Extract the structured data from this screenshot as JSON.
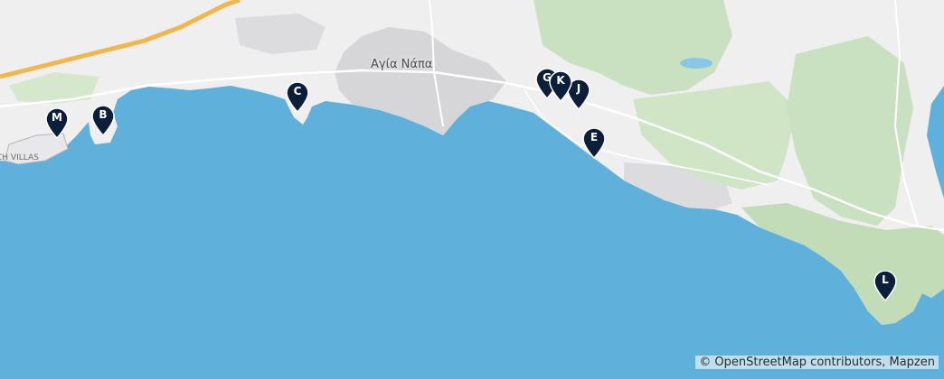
{
  "map": {
    "town_label": "Αγία Νάπα",
    "area_label": "CH VILLAS",
    "attribution": "© OpenStreetMap contributors, Mapzen"
  },
  "markers": [
    {
      "id": "M",
      "label": "M"
    },
    {
      "id": "B",
      "label": "B"
    },
    {
      "id": "C",
      "label": "C"
    },
    {
      "id": "G",
      "label": "G"
    },
    {
      "id": "K",
      "label": "K"
    },
    {
      "id": "J",
      "label": "J"
    },
    {
      "id": "E",
      "label": "E"
    },
    {
      "id": "L",
      "label": "L"
    }
  ],
  "colors": {
    "sea": "#5fb0db",
    "land": "#efefef",
    "urban": "#d6d6d9",
    "forest": "#c9e1c0",
    "highway": "#f0b74a",
    "marker": "#0b1f3a"
  }
}
